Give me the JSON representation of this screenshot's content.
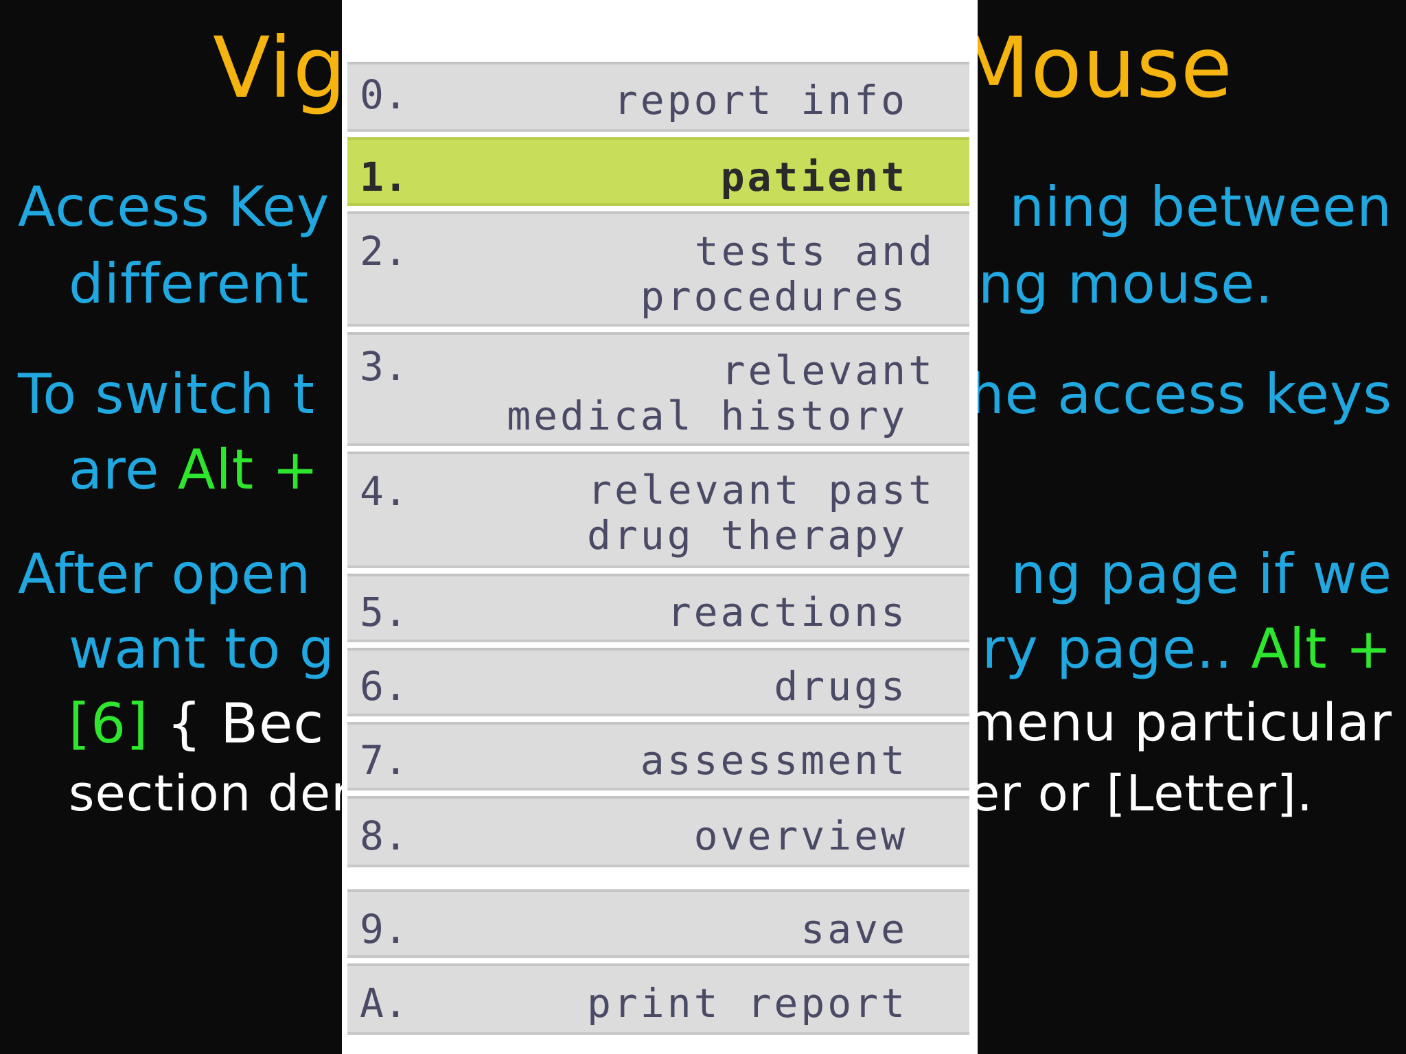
{
  "slide": {
    "title_left": "Vig",
    "title_right": "Mouse",
    "lines_left": [
      "Access Key",
      "different",
      "To switch t",
      "are",
      "After open",
      "want to g",
      "section der"
    ],
    "alt_plus": "Alt +",
    "bracket_6": "[6]",
    "brace_bec": "{  Bec",
    "lines_right": [
      "ning  between",
      "ng mouse.",
      "he access keys",
      "ng page if we",
      "ry page..",
      "menu  particular",
      "er or [Letter]."
    ]
  },
  "menu": {
    "items": [
      {
        "num": "0.",
        "label": "report info"
      },
      {
        "num": "1.",
        "label": "patient"
      },
      {
        "num": "2.",
        "label_line1": "tests and",
        "label_line2": "procedures"
      },
      {
        "num": "3.",
        "label_line1": "relevant",
        "label_line2": "medical history"
      },
      {
        "num": "4.",
        "label_line1": "relevant past",
        "label_line2": "drug therapy"
      },
      {
        "num": "5.",
        "label": "reactions"
      },
      {
        "num": "6.",
        "label": "drugs"
      },
      {
        "num": "7.",
        "label": "assessment"
      },
      {
        "num": "8.",
        "label": "overview"
      },
      {
        "num": "9.",
        "label": "save"
      },
      {
        "num": "A.",
        "label": "print report"
      }
    ],
    "active_index": 1,
    "colors": {
      "item_bg": "#dcdcdc",
      "active_bg": "#c8de5a",
      "text": "#4a4a66"
    }
  }
}
